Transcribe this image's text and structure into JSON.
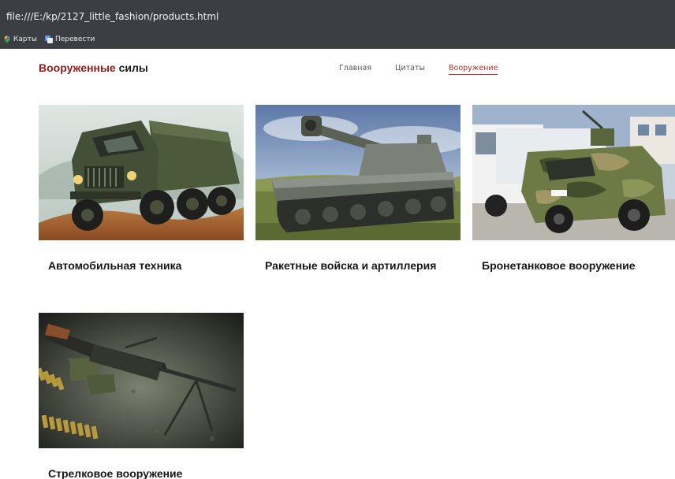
{
  "browser": {
    "address": "file:///E:/kp/2127_little_fashion/products.html",
    "bookmarks": [
      {
        "label": "Карты",
        "icon": "maps-icon"
      },
      {
        "label": "Перевести",
        "icon": "translate-icon"
      }
    ]
  },
  "header": {
    "logo_accent": "Вооруженные",
    "logo_rest": " силы",
    "nav": [
      "Главная",
      "Цитаты",
      "Вооружение"
    ],
    "active_nav": "Вооружение"
  },
  "products": [
    {
      "title": "Автомобильная техника",
      "image": "military-truck-photo"
    },
    {
      "title": "Ракетные войска и артиллерия",
      "image": "self-propelled-howitzer-photo"
    },
    {
      "title": "Бронетанковое вооружение",
      "image": "armored-vehicle-photo"
    },
    {
      "title": "Стрелковое вооружение",
      "image": "machine-gun-photo"
    }
  ],
  "colors": {
    "accent": "#8f1b1b",
    "nav_active": "#b23030",
    "chrome_bg": "#3b3f44"
  }
}
